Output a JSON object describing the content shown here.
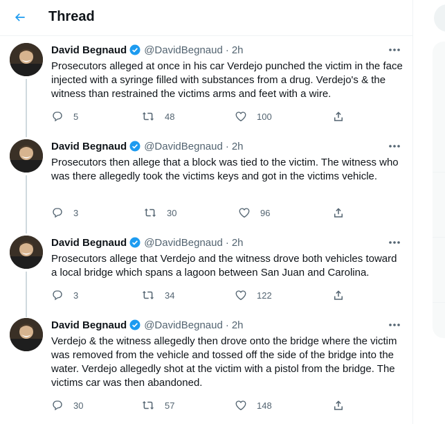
{
  "header": {
    "title": "Thread"
  },
  "tweets": [
    {
      "author": "David Begnaud",
      "handle": "@DavidBegnaud",
      "dot": "·",
      "time": "2h",
      "text": "Prosecutors alleged at once in his car Verdejo punched the victim in the face injected with a syringe filled with substances from a drug.  Verdejo's & the witness than restrained the victims arms and feet with a wire.",
      "replies": "5",
      "retweets": "48",
      "likes": "100"
    },
    {
      "author": "David Begnaud",
      "handle": "@DavidBegnaud",
      "dot": "·",
      "time": "2h",
      "text": "Prosecutors then allege that a block was tied to the victim. The witness who was there allegedly took the victims keys and got in the victims vehicle.",
      "replies": "3",
      "retweets": "30",
      "likes": "96"
    },
    {
      "author": "David Begnaud",
      "handle": "@DavidBegnaud",
      "dot": "·",
      "time": "2h",
      "text": "Prosecutors allege that Verdejo and the witness drove both vehicles toward a local bridge which spans a lagoon between San Juan and Carolina.",
      "replies": "3",
      "retweets": "34",
      "likes": "122"
    },
    {
      "author": "David Begnaud",
      "handle": "@DavidBegnaud",
      "dot": "·",
      "time": "2h",
      "text": "Verdejo & the witness allegedly then drove onto the bridge where the victim was removed from the vehicle and tossed off the side of the bridge into the water. Verdejo allegedly shot at the victim with a pistol from the bridge. The victims car was then abandoned.",
      "replies": "30",
      "retweets": "57",
      "likes": "148"
    }
  ],
  "icons": {
    "back": "arrow-left-icon",
    "verified": "verified-badge-icon",
    "more": "more-horizontal-icon",
    "reply": "reply-icon",
    "retweet": "retweet-icon",
    "like": "heart-icon",
    "share": "share-icon"
  },
  "colors": {
    "accent": "#1d9bf0",
    "text": "#0f1419",
    "secondary": "#536471",
    "border": "#eff3f4",
    "thread_line": "#cfd9de"
  }
}
